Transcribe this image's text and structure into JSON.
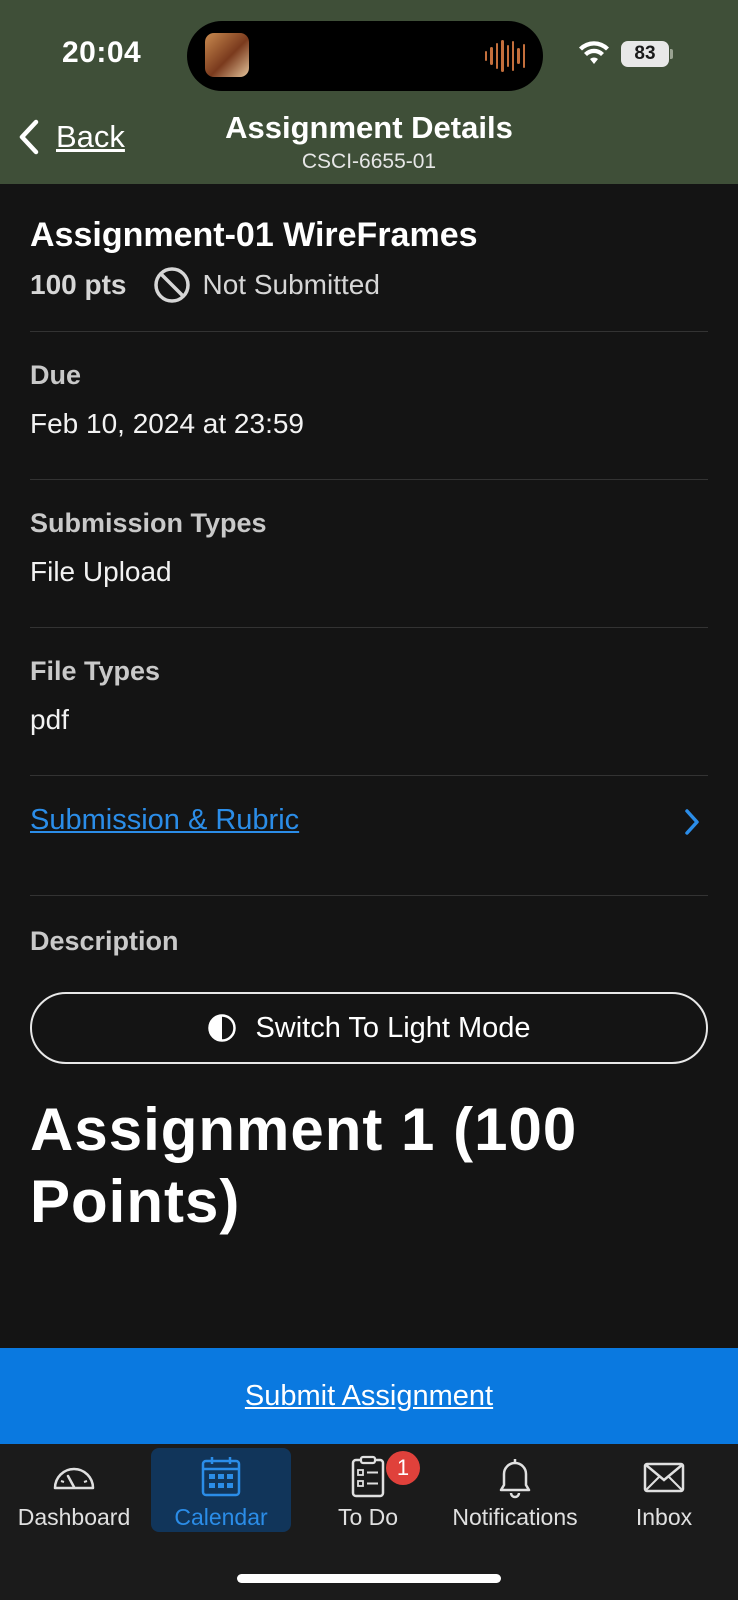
{
  "status_bar": {
    "time": "20:04",
    "battery": "83"
  },
  "header": {
    "back_label": "Back",
    "title": "Assignment Details",
    "subtitle": "CSCI-6655-01"
  },
  "assignment": {
    "title": "Assignment-01 WireFrames",
    "points": "100 pts",
    "submission_status": "Not Submitted"
  },
  "sections": {
    "due_label": "Due",
    "due_value": "Feb 10, 2024 at 23:59",
    "submission_types_label": "Submission Types",
    "submission_types_value": "File Upload",
    "file_types_label": "File Types",
    "file_types_value": "pdf",
    "rubric_link": "Submission & Rubric",
    "description_label": "Description"
  },
  "description": {
    "light_mode_button": "Switch To Light Mode",
    "heading": "Assignment 1 (100 Points)"
  },
  "submit_button": "Submit Assignment",
  "tabbar": {
    "tabs": [
      {
        "label": "Dashboard",
        "icon": "dashboard-icon"
      },
      {
        "label": "Calendar",
        "icon": "calendar-icon",
        "active": true
      },
      {
        "label": "To Do",
        "icon": "todo-icon",
        "badge": "1"
      },
      {
        "label": "Notifications",
        "icon": "bell-icon"
      },
      {
        "label": "Inbox",
        "icon": "mail-icon"
      }
    ]
  },
  "colors": {
    "header_bg": "#3f4f38",
    "background": "#141414",
    "link_blue": "#2b8de8",
    "submit_blue": "#0a79e0",
    "badge_red": "#e0413b"
  }
}
